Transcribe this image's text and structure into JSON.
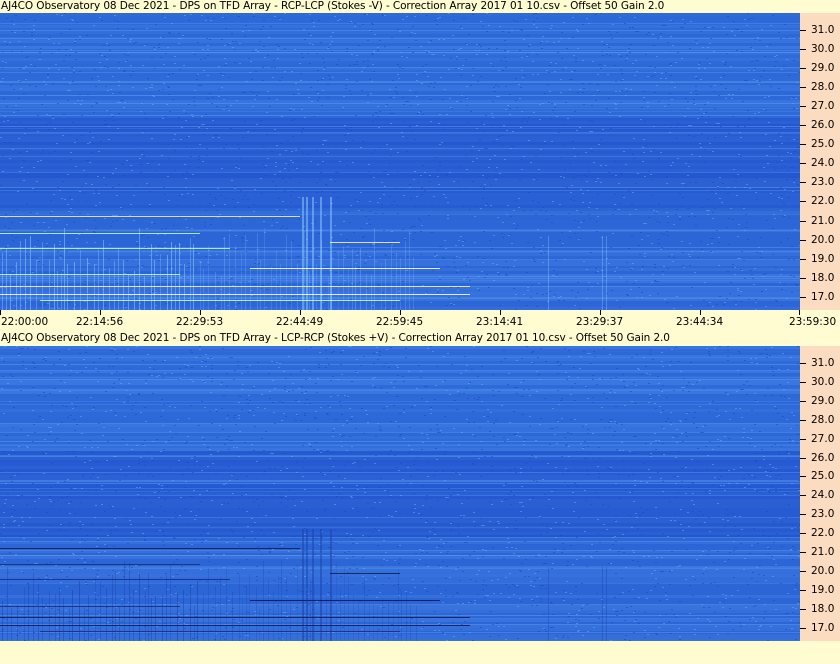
{
  "chart_data": [
    {
      "type": "heatmap",
      "title": "AJ4CO Observatory 08 Dec 2021  -  DPS on TFD Array  -  RCP-LCP (Stokes -V)  -  Correction Array 2017 01 10.csv  -  Offset 50  Gain 2.0",
      "y_tick_labels": [
        "31.0",
        "30.0",
        "29.0",
        "28.0",
        "27.0",
        "26.0",
        "25.0",
        "24.0",
        "23.0",
        "22.0",
        "21.0",
        "20.0",
        "19.0",
        "18.0",
        "17.0"
      ],
      "y_values": [
        31.0,
        30.0,
        29.0,
        28.0,
        27.0,
        26.0,
        25.0,
        24.0,
        23.0,
        22.0,
        21.0,
        20.0,
        19.0,
        18.0,
        17.0
      ],
      "ylim": [
        16.3,
        31.9
      ],
      "colors": {
        "background": "#2a64d6",
        "axis_bg": "#fcdcc0"
      }
    },
    {
      "type": "heatmap",
      "title": "AJ4CO Observatory 08 Dec 2021  -  DPS on TFD Array  -  LCP-RCP (Stokes +V)  -  Correction Array 2017 01 10.csv  -  Offset 50  Gain 2.0",
      "y_tick_labels": [
        "31.0",
        "30.0",
        "29.0",
        "28.0",
        "27.0",
        "26.0",
        "25.0",
        "24.0",
        "23.0",
        "22.0",
        "21.0",
        "20.0",
        "19.0",
        "18.0",
        "17.0"
      ],
      "y_values": [
        31.0,
        30.0,
        29.0,
        28.0,
        27.0,
        26.0,
        25.0,
        24.0,
        23.0,
        22.0,
        21.0,
        20.0,
        19.0,
        18.0,
        17.0
      ],
      "ylim": [
        16.3,
        31.9
      ],
      "colors": {
        "background": "#2a5fd2",
        "axis_bg": "#fcdcc0"
      }
    }
  ],
  "x_axis": {
    "tick_labels": [
      "22:00:00",
      "22:14:56",
      "22:29:53",
      "22:44:49",
      "22:59:45",
      "23:14:41",
      "23:29:37",
      "23:44:34",
      "23:59:30"
    ]
  }
}
